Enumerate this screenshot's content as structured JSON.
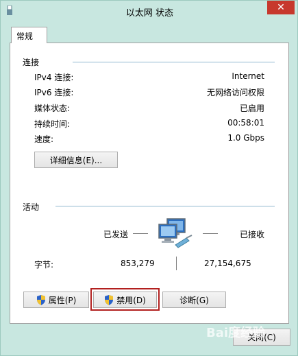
{
  "window": {
    "title": "以太网 状态"
  },
  "tabs": [
    {
      "label": "常规"
    }
  ],
  "connection": {
    "section_title": "连接",
    "rows": [
      {
        "label": "IPv4 连接:",
        "value": "Internet"
      },
      {
        "label": "IPv6 连接:",
        "value": "无网络访问权限"
      },
      {
        "label": "媒体状态:",
        "value": "已启用"
      },
      {
        "label": "持续时间:",
        "value": "00:58:01"
      },
      {
        "label": "速度:",
        "value": "1.0 Gbps"
      }
    ],
    "details_button": "详细信息(E)..."
  },
  "activity": {
    "section_title": "活动",
    "sent_label": "已发送",
    "received_label": "已接收",
    "bytes_label": "字节:",
    "bytes_sent": "853,279",
    "bytes_received": "27,154,675"
  },
  "buttons": {
    "properties": "属性(P)",
    "disable": "禁用(D)",
    "diagnose": "诊断(G)",
    "close": "关闭(C)"
  },
  "watermark": "Bai度经验"
}
